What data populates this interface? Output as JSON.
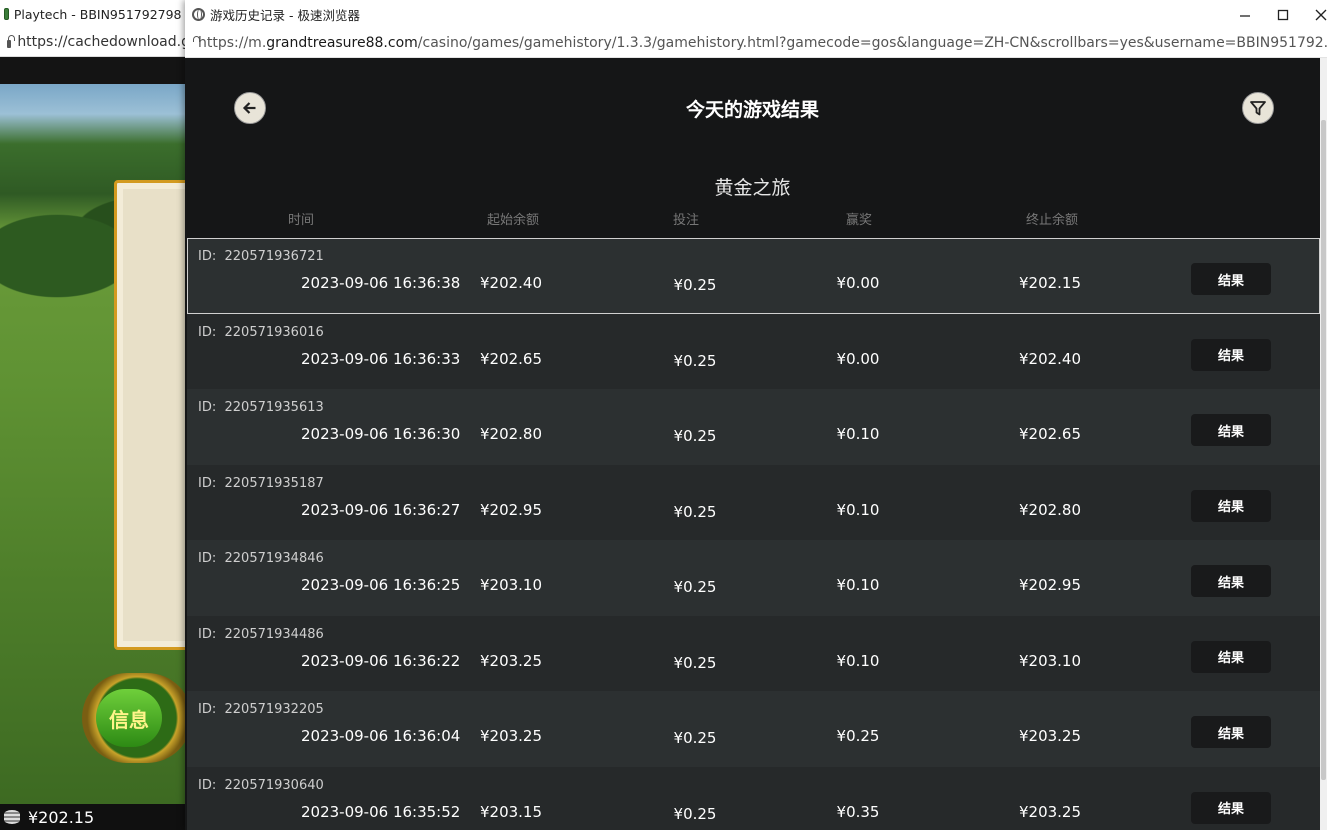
{
  "background_window": {
    "title": "Playtech - BBIN951792798 -",
    "url": "https://cachedownload.g",
    "info_button": "信息",
    "balance": "¥202.15"
  },
  "window": {
    "title": "游戏历史记录 - 极速浏览器",
    "url_prefix": "https://m.",
    "url_host": "grandtreasure88.com",
    "url_rest": "/casino/games/gamehistory/1.3.3/gamehistory.html?gamecode=gos&language=ZH-CN&scrollbars=yes&username=BBIN951792..."
  },
  "page": {
    "title": "今天的游戏结果",
    "game_name": "黄金之旅",
    "columns": [
      "时间",
      "起始余额",
      "投注",
      "赢奖",
      "终止余额"
    ],
    "id_prefix": "ID:",
    "result_label": "结果"
  },
  "rows": [
    {
      "id": "220571936721",
      "time": "2023-09-06  16:36:38",
      "start": "¥202.40",
      "bet": "¥0.25",
      "win": "¥0.00",
      "end": "¥202.15",
      "selected": true
    },
    {
      "id": "220571936016",
      "time": "2023-09-06  16:36:33",
      "start": "¥202.65",
      "bet": "¥0.25",
      "win": "¥0.00",
      "end": "¥202.40"
    },
    {
      "id": "220571935613",
      "time": "2023-09-06  16:36:30",
      "start": "¥202.80",
      "bet": "¥0.25",
      "win": "¥0.10",
      "end": "¥202.65"
    },
    {
      "id": "220571935187",
      "time": "2023-09-06  16:36:27",
      "start": "¥202.95",
      "bet": "¥0.25",
      "win": "¥0.10",
      "end": "¥202.80"
    },
    {
      "id": "220571934846",
      "time": "2023-09-06  16:36:25",
      "start": "¥203.10",
      "bet": "¥0.25",
      "win": "¥0.10",
      "end": "¥202.95"
    },
    {
      "id": "220571934486",
      "time": "2023-09-06  16:36:22",
      "start": "¥203.25",
      "bet": "¥0.25",
      "win": "¥0.10",
      "end": "¥203.10"
    },
    {
      "id": "220571932205",
      "time": "2023-09-06  16:36:04",
      "start": "¥203.25",
      "bet": "¥0.25",
      "win": "¥0.25",
      "end": "¥203.25"
    },
    {
      "id": "220571930640",
      "time": "2023-09-06  16:35:52",
      "start": "¥203.15",
      "bet": "¥0.25",
      "win": "¥0.35",
      "end": "¥203.25"
    }
  ],
  "icons": {
    "back": "arrow-left-icon",
    "filter": "filter-icon"
  }
}
